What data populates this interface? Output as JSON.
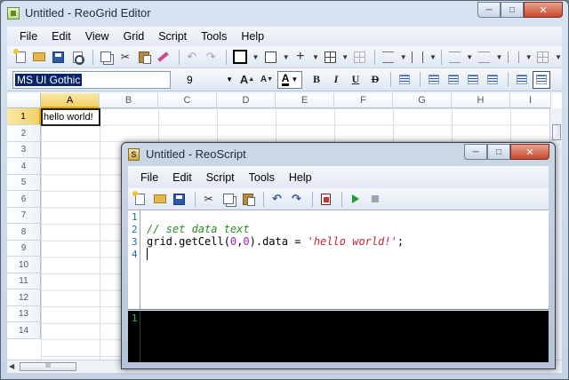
{
  "main_window": {
    "title": "Untitled - ReoGrid Editor",
    "menu": [
      "File",
      "Edit",
      "View",
      "Grid",
      "Script",
      "Tools",
      "Help"
    ],
    "format_bar": {
      "font_name": "MS UI Gothic",
      "font_size": "9",
      "bold": "B",
      "italic": "I",
      "underline": "U",
      "strikethrough": "D",
      "font_color_glyph": "A",
      "grow_font": "A",
      "shrink_font": "A"
    },
    "columns": [
      "A",
      "B",
      "C",
      "D",
      "E",
      "F",
      "G",
      "H",
      "I"
    ],
    "rows": [
      "1",
      "2",
      "3",
      "4",
      "5",
      "6",
      "7",
      "8",
      "9",
      "10",
      "11",
      "12",
      "13",
      "14"
    ],
    "selected_cell": {
      "column": "A",
      "row": "1",
      "value": "hello world!"
    },
    "hscroll_grip": "III"
  },
  "script_window": {
    "title": "Untitled - ReoScript",
    "menu": [
      "File",
      "Edit",
      "Script",
      "Tools",
      "Help"
    ],
    "editor": {
      "line_numbers": [
        "1",
        "2",
        "3",
        "4"
      ],
      "line2_comment": "// set data text",
      "line3_a": "grid.getCell(",
      "line3_num1": "0",
      "line3_comma": ",",
      "line3_num2": "0",
      "line3_b": ").data = ",
      "line3_str": "'hello world!'",
      "line3_end": ";"
    },
    "console": {
      "line_numbers": [
        "1"
      ]
    }
  },
  "icons": {
    "main_toolbar": [
      "new-icon",
      "open-icon",
      "save-icon",
      "print-preview-icon",
      "copy-icon",
      "cut-icon",
      "paste-icon",
      "format-brush-icon",
      "undo-icon",
      "redo-icon",
      "border-box-icon",
      "border-outline-icon",
      "border-inside-icon",
      "border-all-icon",
      "grid-icon",
      "line-icons"
    ],
    "script_toolbar": [
      "new-icon",
      "open-icon",
      "save-icon",
      "cut-icon",
      "copy-icon",
      "paste-icon",
      "undo-icon",
      "redo-icon",
      "document-icon",
      "run-icon",
      "stop-icon"
    ]
  },
  "colors": {
    "selection_header": "#f1cf6b",
    "console_bg": "#000000",
    "comment": "#2a8a2a",
    "string": "#c8203e",
    "number": "#a020c0"
  }
}
